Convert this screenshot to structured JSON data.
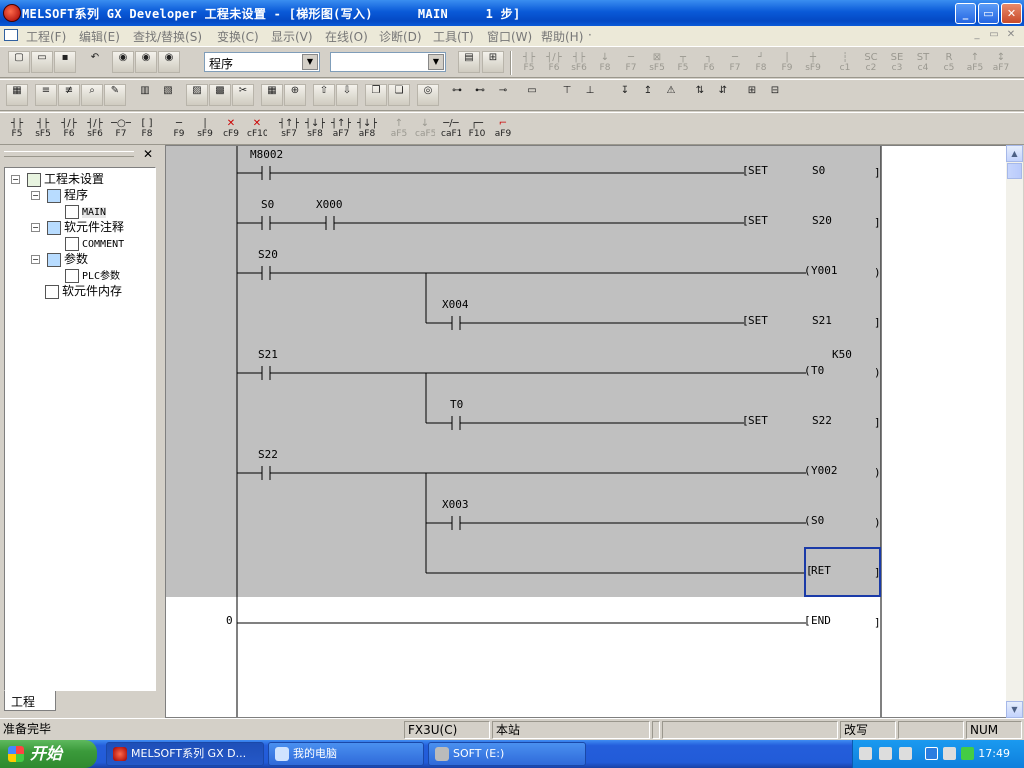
{
  "window": {
    "title": "MELSOFT系列 GX Developer 工程未设置 - [梯形图(写入)      MAIN     1 步]",
    "controls": [
      "_",
      "▭",
      "✕"
    ]
  },
  "menu": {
    "items": [
      "工程(F)",
      "编辑(E)",
      "查找/替换(S)",
      "变换(C)",
      "显示(V)",
      "在线(O)",
      "诊断(D)",
      "工具(T)",
      "窗口(W)",
      "帮助(H)"
    ],
    "extra": "·",
    "mdi_controls": [
      "_",
      "▭",
      "✕"
    ]
  },
  "toolbar1": {
    "program_select": "程序",
    "second_select": "",
    "fkeys": [
      "F5",
      "F6",
      "sF6",
      "F8",
      "F7",
      "sF5",
      "F5",
      "F6",
      "F7",
      "F8",
      "F9",
      "sF9",
      "c1",
      "c2",
      "c3",
      "c4",
      "c5",
      "aF5",
      "aF7"
    ]
  },
  "toolbar3": {
    "keys": [
      "F5",
      "sF5",
      "F6",
      "sF6",
      "F7",
      "F8",
      "F9",
      "sF9",
      "cF9",
      "cF10",
      "sF7",
      "sF8",
      "aF7",
      "aF8",
      "aF5",
      "caF5",
      "caF10",
      "F10",
      "aF9"
    ]
  },
  "project_tree": {
    "root": "工程未设置",
    "program_folder": "程序",
    "main": "MAIN",
    "comment_folder": "软元件注释",
    "comment": "COMMENT",
    "param_folder": "参数",
    "plc_param": "PLC参数",
    "memory": "软元件内存",
    "tab": "工程"
  },
  "ladder": {
    "rungs": [
      {
        "contacts": [
          "M8002"
        ],
        "instr": "SET",
        "operand": "S0"
      },
      {
        "contacts": [
          "S0",
          "X000"
        ],
        "instr": "SET",
        "operand": "S20"
      },
      {
        "contacts": [
          "S20"
        ],
        "coil": "Y001",
        "branch": {
          "contact": "X004",
          "instr": "SET",
          "operand": "S21"
        }
      },
      {
        "contacts": [
          "S21"
        ],
        "coil": "T0",
        "const": "K50",
        "branch": {
          "contact": "T0",
          "instr": "SET",
          "operand": "S22"
        }
      },
      {
        "contacts": [
          "S22"
        ],
        "coil": "Y002",
        "branch": {
          "contact": "X003",
          "coil": "S0"
        },
        "ret": "RET"
      },
      {
        "step": "0",
        "end": "END"
      }
    ]
  },
  "statusbar": {
    "ready": "准备完毕",
    "plc": "FX3U(C)",
    "station": "本站",
    "mode": "改写",
    "num": "NUM"
  },
  "taskbar": {
    "start": "开始",
    "tasks": [
      "MELSOFT系列 GX D...",
      "我的电脑",
      "SOFT (E:)"
    ],
    "clock": "17:49"
  }
}
